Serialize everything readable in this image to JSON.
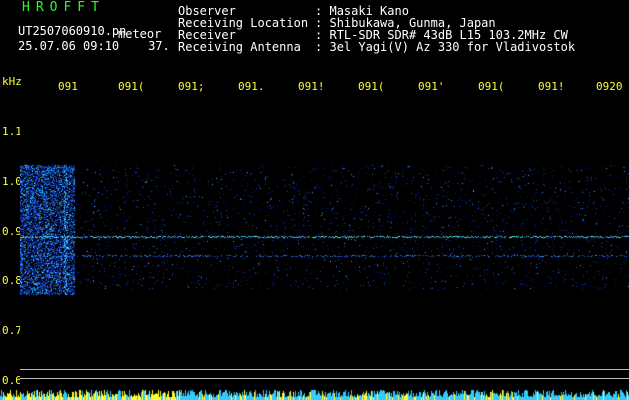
{
  "header": {
    "app_title": "HROFFT",
    "file_name": "UT2507060910.pn",
    "file_suffix": "meteor",
    "datetime": "25.07.06 09:10",
    "count": "37.",
    "fields": [
      {
        "label": "Observer",
        "sep": ":",
        "value": "Masaki Kano"
      },
      {
        "label": "Receiving Location",
        "sep": ":",
        "value": "Shibukawa, Gunma, Japan"
      },
      {
        "label": "Receiver",
        "sep": ":",
        "value": "RTL-SDR SDR# 43dB L15 103.2MHz CW"
      },
      {
        "label": "Receiving Antenna",
        "sep": ":",
        "value": "3el Yagi(V) Az 330 for Vladivostok"
      }
    ]
  },
  "axis": {
    "unit": "kHz",
    "y_labels": [
      "1.1",
      "1.0",
      "0.9",
      "0.8",
      "0.7",
      "0.6"
    ],
    "time_labels": [
      "091",
      "091(",
      "091;",
      "091.",
      "091!",
      "091(",
      "091'",
      "091(",
      "091!",
      "0920"
    ]
  },
  "colors": {
    "title": "#22ff22",
    "header_text": "#ffffff",
    "axis_label": "#ffff33",
    "background": "#000000",
    "signal_bright": "#33ffff",
    "signal_mid": "#3366ff",
    "strip_yellow": "#ffff33",
    "strip_cyan": "#33ccff"
  }
}
